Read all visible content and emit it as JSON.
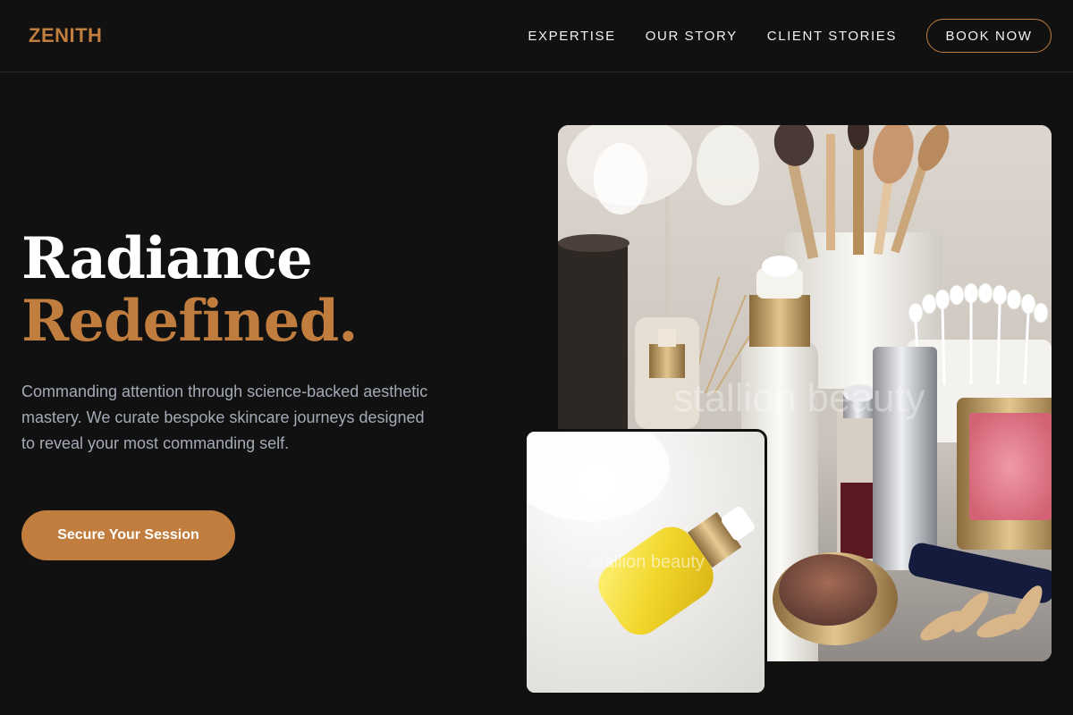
{
  "header": {
    "logo": "ZENITH",
    "nav": [
      "EXPERTISE",
      "OUR STORY",
      "CLIENT STORIES"
    ],
    "book_label": "BOOK NOW"
  },
  "hero": {
    "title_line1": "Radiance",
    "title_line2": "Redefined.",
    "description": "Commanding attention through science-backed aesthetic mastery. We curate bespoke skincare journeys designed to reveal your most commanding self.",
    "cta_label": "Secure Your Session"
  },
  "images": {
    "main_watermark": "stallion beauty",
    "secondary_watermark": "stallion beauty"
  },
  "colors": {
    "background": "#111111",
    "accent": "#c07d3e",
    "text": "#ffffff",
    "muted": "#a4abb6"
  }
}
